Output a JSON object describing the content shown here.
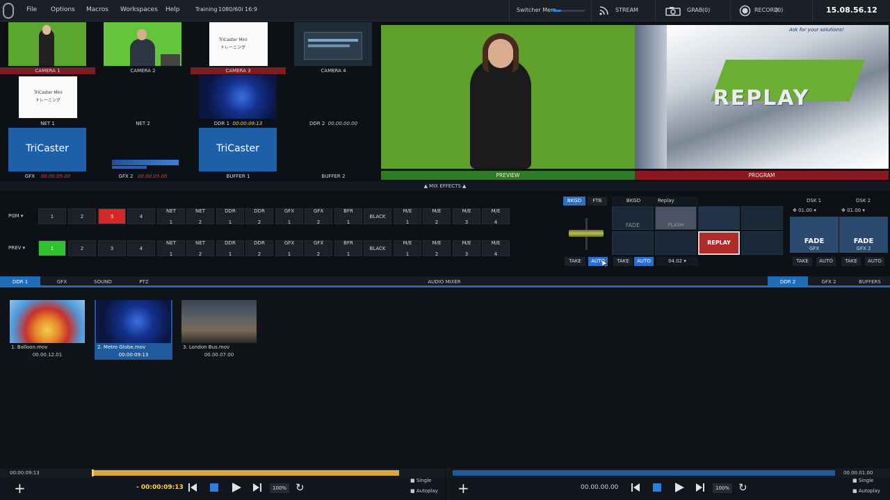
{
  "topbar": {
    "menu": [
      "File",
      "Options",
      "Macros",
      "Workspaces",
      "Help"
    ],
    "session": "Training",
    "format": "1080/60i 16:9",
    "switcher_mem": "Switcher Mem",
    "stream": "STREAM",
    "grab": "GRAB",
    "grab_count": "(0)",
    "record": "RECORD",
    "record_count": "(0)",
    "clock": "15.08.56.12"
  },
  "monitors": [
    {
      "label": "CAMERA 1",
      "tally": "program"
    },
    {
      "label": "CAMERA 2",
      "tally": "none"
    },
    {
      "label": "CAMERA 3",
      "tally": "program"
    },
    {
      "label": "CAMERA 4",
      "tally": "none"
    },
    {
      "label": "NET 1",
      "tally": "none",
      "thumb_title": "TriCaster Mini",
      "thumb_sub": "トレーニング"
    },
    {
      "label": "NET 2",
      "tally": "none"
    },
    {
      "label": "DDR 1",
      "tally": "none",
      "timecode": "00:00:09:13"
    },
    {
      "label": "DDR 2",
      "tally": "none",
      "timecode": "00.00.00.00"
    },
    {
      "label": "GFX",
      "tally": "none",
      "timecode": "00.00.05.00",
      "thumb_title": "TriCaster"
    },
    {
      "label": "GFX 2",
      "tally": "none",
      "timecode": "00.00.05.00"
    },
    {
      "label": "BUFFER 1",
      "tally": "none",
      "thumb_title": "TriCaster"
    },
    {
      "label": "BUFFER 2",
      "tally": "none"
    }
  ],
  "preview_label": "PREVIEW",
  "program_label": "PROGRAM",
  "program_overlay": {
    "title": "REPLAY",
    "tagline": "Ask for your solutions!"
  },
  "mix_effects_label": "MIX EFFECTS",
  "switcher": {
    "pgm_label": "PGM",
    "prev_label": "PREV",
    "buttons": [
      [
        "1",
        ""
      ],
      [
        "2",
        ""
      ],
      [
        "3",
        ""
      ],
      [
        "4",
        ""
      ],
      [
        "NET",
        "1"
      ],
      [
        "NET",
        "2"
      ],
      [
        "DDR",
        "1"
      ],
      [
        "DDR",
        "2"
      ],
      [
        "GFX",
        "1"
      ],
      [
        "GFX",
        "2"
      ],
      [
        "BFR",
        "1"
      ],
      [
        "BLACK",
        ""
      ],
      [
        "M/E",
        "1"
      ],
      [
        "M/E",
        "2"
      ],
      [
        "M/E",
        "3"
      ],
      [
        "M/E",
        "4"
      ]
    ],
    "pgm_active": 2,
    "prev_active": 0
  },
  "transition": {
    "bkgd": "BKGD",
    "ftb": "FTB",
    "take": "TAKE",
    "auto": "AUTO",
    "bkgd2": "BKGD",
    "replay": "Replay",
    "take2": "TAKE",
    "auto2": "AUTO",
    "duration": "04.02",
    "tiles": [
      "FADE",
      "FLASH",
      "",
      "",
      "",
      "",
      "REPLAY",
      ""
    ]
  },
  "dsk": [
    {
      "name": "DSK 1",
      "rate": "01.00",
      "effect": "FADE",
      "source": "GFX",
      "take": "TAKE",
      "auto": "AUTO"
    },
    {
      "name": "DSK 2",
      "rate": "01.00",
      "effect": "FADE",
      "source": "GFX 2",
      "take": "TAKE",
      "auto": "AUTO"
    }
  ],
  "tabs_left": [
    "DDR 1",
    "GFX",
    "SOUND",
    "PTZ"
  ],
  "audio_mixer": "AUDIO MIXER",
  "tabs_right": [
    "DDR 2",
    "GFX 2",
    "BUFFERS"
  ],
  "clips": [
    {
      "name": "1. Balloon.mov",
      "duration": "00.00.12.01",
      "selected": false
    },
    {
      "name": "2. Metro Globe.mov",
      "duration": "00:00:09:13",
      "selected": true
    },
    {
      "name": "3. London Bus.mov",
      "duration": "00.00.07.00",
      "selected": false
    }
  ],
  "ddr1": {
    "scrub_time": "00:00:09:13",
    "remaining": "- 00:00:09:13",
    "zoom": "100%",
    "single": "Single",
    "autoplay": "Autoplay"
  },
  "ddr2": {
    "scrub_time": "00.00.01.00",
    "time": "00.00.00.00",
    "zoom": "100%",
    "single": "Single",
    "autoplay": "Autoplay"
  },
  "colors": {
    "accent": "#1f6db8",
    "program_red": "#d22828",
    "preview_green": "#2fc22f",
    "timeline_gold": "#d9a73a"
  }
}
